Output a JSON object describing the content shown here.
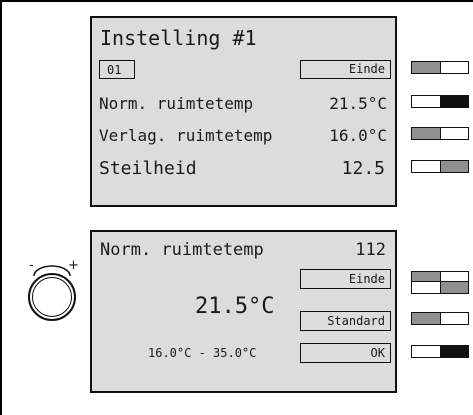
{
  "screen1": {
    "title": "Instelling #1",
    "index_badge": "01",
    "end_button": "Einde",
    "rows": [
      {
        "label": "Norm. ruimtetemp",
        "value": "21.5°C"
      },
      {
        "label": "Verlag. ruimtetemp",
        "value": "16.0°C"
      },
      {
        "label": "Steilheid",
        "value": "12.5"
      }
    ]
  },
  "screen2": {
    "title": "Norm. ruimtetemp",
    "code": "112",
    "end_button": "Einde",
    "big_value": "21.5°C",
    "standard_button": "Standard",
    "range": "16.0°C - 35.0°C",
    "ok_button": "OK"
  },
  "knob": {
    "minus": "-",
    "plus": "+"
  },
  "softkeys": {
    "screen1": [
      "gray-white",
      "white-black",
      "gray-white",
      "white-gray"
    ],
    "screen2": [
      "gray-white",
      "white-gray",
      "gray-white",
      "white-black"
    ]
  }
}
